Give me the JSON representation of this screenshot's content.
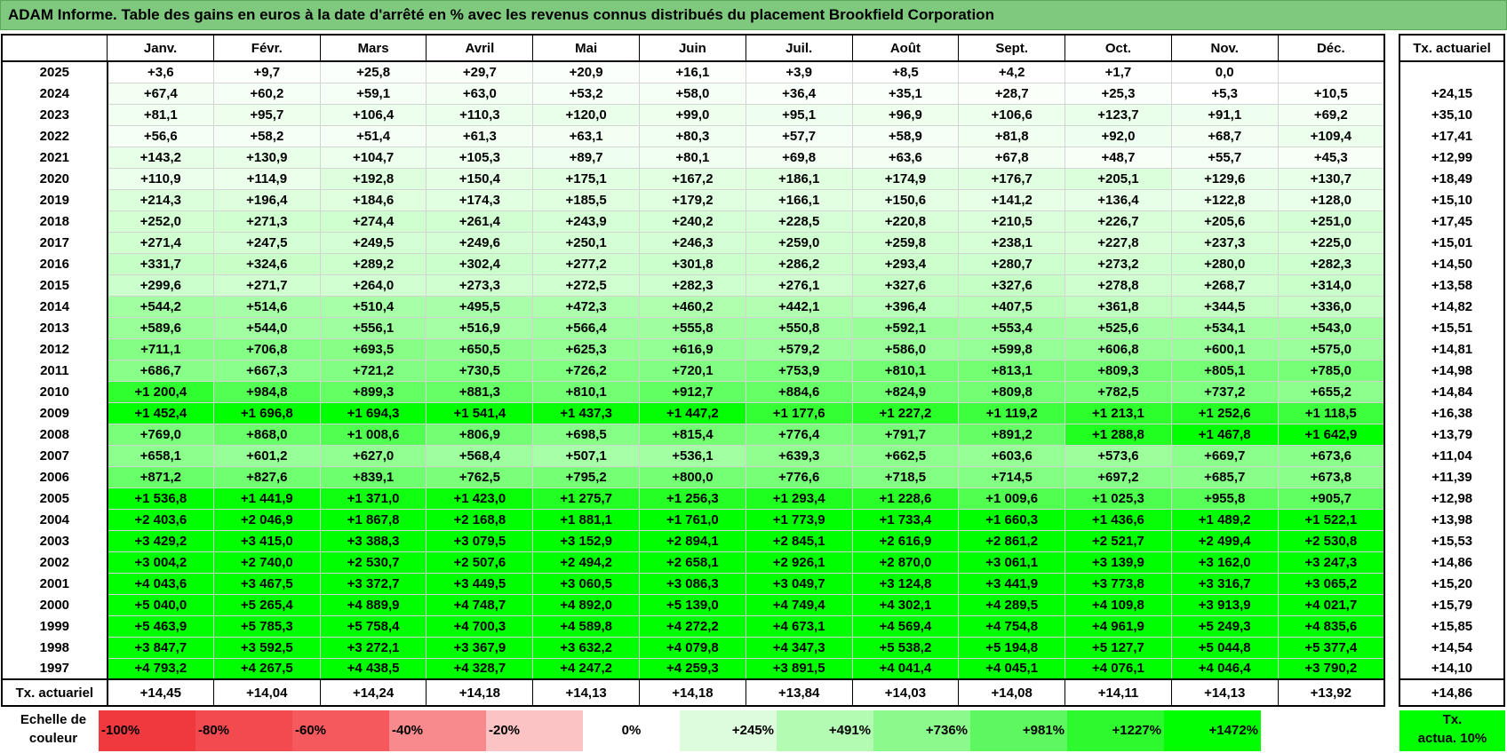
{
  "title": "ADAM Informe. Table des gains en euros à la date d'arrêté en % avec les revenus connus distribués du placement Brookfield Corporation",
  "months": [
    "Janv.",
    "Févr.",
    "Mars",
    "Avril",
    "Mai",
    "Juin",
    "Juil.",
    "Août",
    "Sept.",
    "Oct.",
    "Nov.",
    "Déc."
  ],
  "actu_header": "Tx. actuariel",
  "colors": {
    "header": "#7fc97f",
    "max_green": "#00ff00",
    "white": "#ffffff"
  },
  "rows": [
    {
      "year": "2025",
      "values": [
        "+3,6",
        "+9,7",
        "+25,8",
        "+29,7",
        "+20,9",
        "+16,1",
        "+3,9",
        "+8,5",
        "+4,2",
        "+1,7",
        "0,0",
        ""
      ],
      "actu": ""
    },
    {
      "year": "2024",
      "values": [
        "+67,4",
        "+60,2",
        "+59,1",
        "+63,0",
        "+53,2",
        "+58,0",
        "+36,4",
        "+35,1",
        "+28,7",
        "+25,3",
        "+5,3",
        "+10,5"
      ],
      "actu": "+24,15"
    },
    {
      "year": "2023",
      "values": [
        "+81,1",
        "+95,7",
        "+106,4",
        "+110,3",
        "+120,0",
        "+99,0",
        "+95,1",
        "+96,9",
        "+106,6",
        "+123,7",
        "+91,1",
        "+69,2"
      ],
      "actu": "+35,10"
    },
    {
      "year": "2022",
      "values": [
        "+56,6",
        "+58,2",
        "+51,4",
        "+61,3",
        "+63,1",
        "+80,3",
        "+57,7",
        "+58,9",
        "+81,8",
        "+92,0",
        "+68,7",
        "+109,4"
      ],
      "actu": "+17,41"
    },
    {
      "year": "2021",
      "values": [
        "+143,2",
        "+130,9",
        "+104,7",
        "+105,3",
        "+89,7",
        "+80,1",
        "+69,8",
        "+63,6",
        "+67,8",
        "+48,7",
        "+55,7",
        "+45,3"
      ],
      "actu": "+12,99"
    },
    {
      "year": "2020",
      "values": [
        "+110,9",
        "+114,9",
        "+192,8",
        "+150,4",
        "+175,1",
        "+167,2",
        "+186,1",
        "+174,9",
        "+176,7",
        "+205,1",
        "+129,6",
        "+130,7"
      ],
      "actu": "+18,49"
    },
    {
      "year": "2019",
      "values": [
        "+214,3",
        "+196,4",
        "+184,6",
        "+174,3",
        "+185,5",
        "+179,2",
        "+166,1",
        "+150,6",
        "+141,2",
        "+136,4",
        "+122,8",
        "+128,0"
      ],
      "actu": "+15,10"
    },
    {
      "year": "2018",
      "values": [
        "+252,0",
        "+271,3",
        "+274,4",
        "+261,4",
        "+243,9",
        "+240,2",
        "+228,5",
        "+220,8",
        "+210,5",
        "+226,7",
        "+205,6",
        "+251,0"
      ],
      "actu": "+17,45"
    },
    {
      "year": "2017",
      "values": [
        "+271,4",
        "+247,5",
        "+249,5",
        "+249,6",
        "+250,1",
        "+246,3",
        "+259,0",
        "+259,8",
        "+238,1",
        "+227,8",
        "+237,3",
        "+225,0"
      ],
      "actu": "+15,01"
    },
    {
      "year": "2016",
      "values": [
        "+331,7",
        "+324,6",
        "+289,2",
        "+302,4",
        "+277,2",
        "+301,8",
        "+286,2",
        "+293,4",
        "+280,7",
        "+273,2",
        "+280,0",
        "+282,3"
      ],
      "actu": "+14,50"
    },
    {
      "year": "2015",
      "values": [
        "+299,6",
        "+271,7",
        "+264,0",
        "+273,3",
        "+272,5",
        "+282,3",
        "+276,1",
        "+327,6",
        "+327,6",
        "+278,8",
        "+268,7",
        "+314,0"
      ],
      "actu": "+13,58"
    },
    {
      "year": "2014",
      "values": [
        "+544,2",
        "+514,6",
        "+510,4",
        "+495,5",
        "+472,3",
        "+460,2",
        "+442,1",
        "+396,4",
        "+407,5",
        "+361,8",
        "+344,5",
        "+336,0"
      ],
      "actu": "+14,82"
    },
    {
      "year": "2013",
      "values": [
        "+589,6",
        "+544,0",
        "+556,1",
        "+516,9",
        "+566,4",
        "+555,8",
        "+550,8",
        "+592,1",
        "+553,4",
        "+525,6",
        "+534,1",
        "+543,0"
      ],
      "actu": "+15,51"
    },
    {
      "year": "2012",
      "values": [
        "+711,1",
        "+706,8",
        "+693,5",
        "+650,5",
        "+625,3",
        "+616,9",
        "+579,2",
        "+586,0",
        "+599,8",
        "+606,8",
        "+600,1",
        "+575,0"
      ],
      "actu": "+14,81"
    },
    {
      "year": "2011",
      "values": [
        "+686,7",
        "+667,3",
        "+721,2",
        "+730,5",
        "+726,2",
        "+720,1",
        "+753,9",
        "+810,1",
        "+813,1",
        "+809,3",
        "+805,1",
        "+785,0"
      ],
      "actu": "+14,98"
    },
    {
      "year": "2010",
      "values": [
        "+1 200,4",
        "+984,8",
        "+899,3",
        "+881,3",
        "+810,1",
        "+912,7",
        "+884,6",
        "+824,9",
        "+809,8",
        "+782,5",
        "+737,2",
        "+655,2"
      ],
      "actu": "+14,84"
    },
    {
      "year": "2009",
      "values": [
        "+1 452,4",
        "+1 696,8",
        "+1 694,3",
        "+1 541,4",
        "+1 437,3",
        "+1 447,2",
        "+1 177,6",
        "+1 227,2",
        "+1 119,2",
        "+1 213,1",
        "+1 252,6",
        "+1 118,5"
      ],
      "actu": "+16,38"
    },
    {
      "year": "2008",
      "values": [
        "+769,0",
        "+868,0",
        "+1 008,6",
        "+806,9",
        "+698,5",
        "+815,4",
        "+776,4",
        "+791,7",
        "+891,2",
        "+1 288,8",
        "+1 467,8",
        "+1 642,9"
      ],
      "actu": "+13,79"
    },
    {
      "year": "2007",
      "values": [
        "+658,1",
        "+601,2",
        "+627,0",
        "+568,4",
        "+507,1",
        "+536,1",
        "+639,3",
        "+662,5",
        "+603,6",
        "+573,6",
        "+669,7",
        "+673,6"
      ],
      "actu": "+11,04"
    },
    {
      "year": "2006",
      "values": [
        "+871,2",
        "+827,6",
        "+839,1",
        "+762,5",
        "+795,2",
        "+800,0",
        "+776,6",
        "+718,5",
        "+714,5",
        "+697,2",
        "+685,7",
        "+673,8"
      ],
      "actu": "+11,39"
    },
    {
      "year": "2005",
      "values": [
        "+1 536,8",
        "+1 441,9",
        "+1 371,0",
        "+1 423,0",
        "+1 275,7",
        "+1 256,3",
        "+1 293,4",
        "+1 228,6",
        "+1 009,6",
        "+1 025,3",
        "+955,8",
        "+905,7"
      ],
      "actu": "+12,98"
    },
    {
      "year": "2004",
      "values": [
        "+2 403,6",
        "+2 046,9",
        "+1 867,8",
        "+2 168,8",
        "+1 881,1",
        "+1 761,0",
        "+1 773,9",
        "+1 733,4",
        "+1 660,3",
        "+1 436,6",
        "+1 489,2",
        "+1 522,1"
      ],
      "actu": "+13,98"
    },
    {
      "year": "2003",
      "values": [
        "+3 429,2",
        "+3 415,0",
        "+3 388,3",
        "+3 079,5",
        "+3 152,9",
        "+2 894,1",
        "+2 845,1",
        "+2 616,9",
        "+2 861,2",
        "+2 521,7",
        "+2 499,4",
        "+2 530,8"
      ],
      "actu": "+15,53"
    },
    {
      "year": "2002",
      "values": [
        "+3 004,2",
        "+2 740,0",
        "+2 530,7",
        "+2 507,6",
        "+2 494,2",
        "+2 658,1",
        "+2 926,1",
        "+2 870,0",
        "+3 061,1",
        "+3 139,9",
        "+3 162,0",
        "+3 247,3"
      ],
      "actu": "+14,86"
    },
    {
      "year": "2001",
      "values": [
        "+4 043,6",
        "+3 467,5",
        "+3 372,7",
        "+3 449,5",
        "+3 060,5",
        "+3 086,3",
        "+3 049,7",
        "+3 124,8",
        "+3 441,9",
        "+3 773,8",
        "+3 316,7",
        "+3 065,2"
      ],
      "actu": "+15,20"
    },
    {
      "year": "2000",
      "values": [
        "+5 040,0",
        "+5 265,4",
        "+4 889,9",
        "+4 748,7",
        "+4 892,0",
        "+5 139,0",
        "+4 749,4",
        "+4 302,1",
        "+4 289,5",
        "+4 109,8",
        "+3 913,9",
        "+4 021,7"
      ],
      "actu": "+15,79"
    },
    {
      "year": "1999",
      "values": [
        "+5 463,9",
        "+5 785,3",
        "+5 758,4",
        "+4 700,3",
        "+4 589,8",
        "+4 272,2",
        "+4 673,1",
        "+4 569,4",
        "+4 754,8",
        "+4 961,9",
        "+5 249,3",
        "+4 835,6"
      ],
      "actu": "+15,85"
    },
    {
      "year": "1998",
      "values": [
        "+3 847,7",
        "+3 592,5",
        "+3 272,1",
        "+3 367,9",
        "+3 632,2",
        "+4 079,8",
        "+4 347,3",
        "+5 538,2",
        "+5 194,8",
        "+5 127,7",
        "+5 044,8",
        "+5 377,4"
      ],
      "actu": "+14,54"
    },
    {
      "year": "1997",
      "values": [
        "+4 793,2",
        "+4 267,5",
        "+4 438,5",
        "+4 328,7",
        "+4 247,2",
        "+4 259,3",
        "+3 891,5",
        "+4 041,4",
        "+4 045,1",
        "+4 076,1",
        "+4 046,4",
        "+3 790,2"
      ],
      "actu": "+14,10"
    }
  ],
  "total": {
    "label": "Tx. actuariel",
    "values": [
      "+14,45",
      "+14,04",
      "+14,24",
      "+14,18",
      "+14,13",
      "+14,18",
      "+13,84",
      "+14,03",
      "+14,08",
      "+14,11",
      "+14,13",
      "+13,92"
    ],
    "actu": "+14,86"
  },
  "legend": {
    "label_line1": "Echelle de",
    "label_line2": "couleur",
    "cells": [
      {
        "text": "-100%",
        "color": "#f0393f",
        "kind": "neg"
      },
      {
        "text": "-80%",
        "color": "#f34a50",
        "kind": "neg"
      },
      {
        "text": "-60%",
        "color": "#f5585d",
        "kind": "neg"
      },
      {
        "text": "-40%",
        "color": "#f88a8d",
        "kind": "neg"
      },
      {
        "text": "-20%",
        "color": "#fbc3c4",
        "kind": "neg"
      },
      {
        "text": "0%",
        "color": "#ffffff",
        "kind": "zero"
      },
      {
        "text": "+245%",
        "color": "#ddfcdd",
        "kind": "pos"
      },
      {
        "text": "+491%",
        "color": "#b3fbb3",
        "kind": "pos"
      },
      {
        "text": "+736%",
        "color": "#8cf98c",
        "kind": "pos"
      },
      {
        "text": "+981%",
        "color": "#5ff75f",
        "kind": "pos"
      },
      {
        "text": "+1227%",
        "color": "#2ef82e",
        "kind": "pos"
      },
      {
        "text": "+1472%",
        "color": "#00ff00",
        "kind": "pos"
      }
    ],
    "actu_line1": "Tx.",
    "actu_line2": "actua. 10%"
  }
}
